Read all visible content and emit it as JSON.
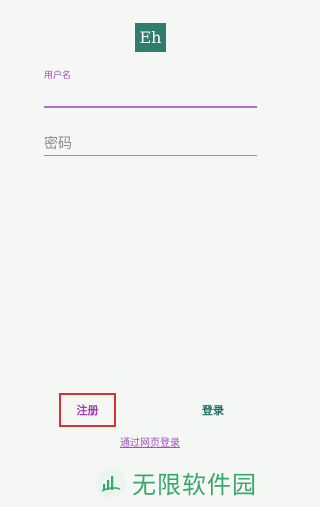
{
  "app": {
    "logo_text": "Eh"
  },
  "form": {
    "username_label": "用户名",
    "username_value": "",
    "password_placeholder": "密码",
    "password_value": ""
  },
  "actions": {
    "register_label": "注册",
    "login_label": "登录",
    "web_login_label": "通过网页登录"
  },
  "watermark": {
    "text": "无限软件园",
    "icon": "bars-badge-icon"
  },
  "colors": {
    "background": "#f5f7f5",
    "logo": "#2e7d6e",
    "accent_purple": "#a44fc2",
    "login_green": "#1f6f62",
    "highlight_box": "#d83232",
    "watermark_green": "#39a86d"
  }
}
